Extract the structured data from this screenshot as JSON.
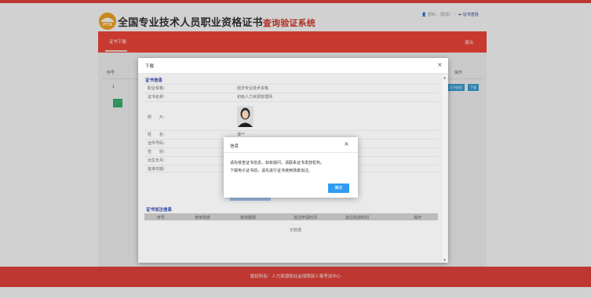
{
  "header": {
    "logo_text": "PTR",
    "title_main": "全国专业技术人员职业资格证书",
    "title_sub": "查询验证系统",
    "user_links": "您好，（隐去）｜",
    "verify_link": "证书查验"
  },
  "nav": {
    "tab": "证书下载",
    "exit": "退出"
  },
  "background_table": {
    "col_seq": "序号",
    "col_op": "操作",
    "row_seq": "1",
    "btn_verify": "证书查验",
    "btn_download": "下载",
    "pager": "1"
  },
  "modal": {
    "title": "下载",
    "section_info": "证书信息",
    "rows": [
      {
        "label": "职业资格：",
        "value": "经济专业技术资格"
      },
      {
        "label": "证书名称：",
        "value": "初级人力资源管理师"
      },
      {
        "label": "照　　片：",
        "value": ""
      },
      {
        "label": "姓　　名：",
        "value": "谭**"
      },
      {
        "label": "证件号码：",
        "value": ""
      },
      {
        "label": "性　　别：",
        "value": ""
      },
      {
        "label": "出生年月：",
        "value": ""
      },
      {
        "label": "批准日期：",
        "value": ""
      }
    ],
    "section_records": "证书加注信息",
    "rec_cols": [
      "序号",
      "使用场景",
      "有效期限",
      "加注申请时间",
      "加注完成时间",
      "操作"
    ],
    "empty": "无数据"
  },
  "dialog": {
    "title": "信息",
    "line1": "请先核查证书信息，如有疑问，请联系证书发放机构。",
    "line2": "下载电子证书前，请先进行证书使用场景加注。",
    "ok": "确定"
  },
  "footer": {
    "text": "版权所有：人力资源和社会保障部人事考试中心"
  },
  "colors": {
    "brand_red": "#f4473b",
    "link_blue": "#2b3ea0",
    "ok_blue": "#2f9bf0"
  }
}
